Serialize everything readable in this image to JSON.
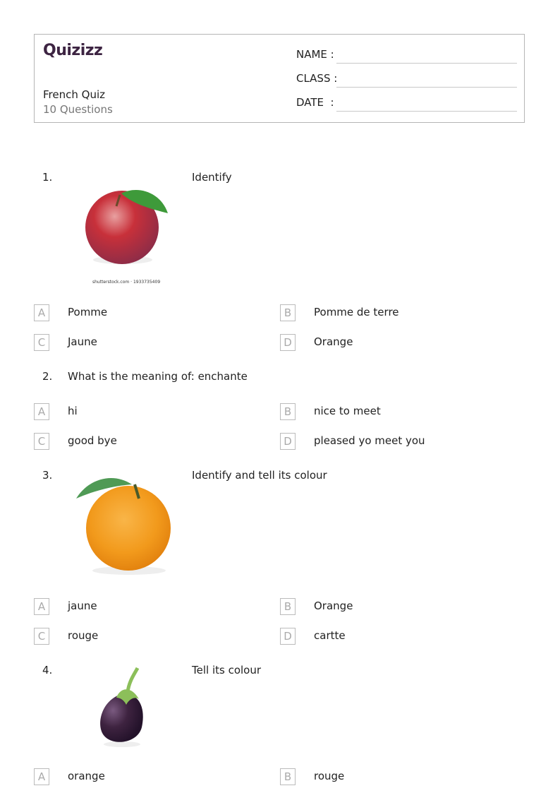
{
  "header": {
    "logo": "Quizizz",
    "logo_color": "#3d2442",
    "title": "French Quiz",
    "subtitle": "10 Questions",
    "fields": [
      {
        "label": "NAME :"
      },
      {
        "label": "CLASS :"
      },
      {
        "label": "DATE  :"
      }
    ]
  },
  "questions": [
    {
      "number": "1.",
      "text": "Identify",
      "image": "apple-image",
      "image_credit": "shutterstock.com · 1933735409",
      "options": [
        {
          "letter": "A",
          "text": "Pomme"
        },
        {
          "letter": "B",
          "text": "Pomme de terre"
        },
        {
          "letter": "C",
          "text": "Jaune"
        },
        {
          "letter": "D",
          "text": "Orange"
        }
      ]
    },
    {
      "number": "2.",
      "text": "What is the meaning of: enchante",
      "options": [
        {
          "letter": "A",
          "text": "hi"
        },
        {
          "letter": "B",
          "text": "nice to meet"
        },
        {
          "letter": "C",
          "text": "good bye"
        },
        {
          "letter": "D",
          "text": "pleased yo meet you"
        }
      ]
    },
    {
      "number": "3.",
      "text": "Identify and tell its colour",
      "image": "orange-image",
      "options": [
        {
          "letter": "A",
          "text": "jaune"
        },
        {
          "letter": "B",
          "text": "Orange"
        },
        {
          "letter": "C",
          "text": "rouge"
        },
        {
          "letter": "D",
          "text": "cartte"
        }
      ]
    },
    {
      "number": "4.",
      "text": "Tell its colour",
      "image": "eggplant-image",
      "options": [
        {
          "letter": "A",
          "text": "orange"
        },
        {
          "letter": "B",
          "text": "rouge"
        }
      ]
    }
  ]
}
